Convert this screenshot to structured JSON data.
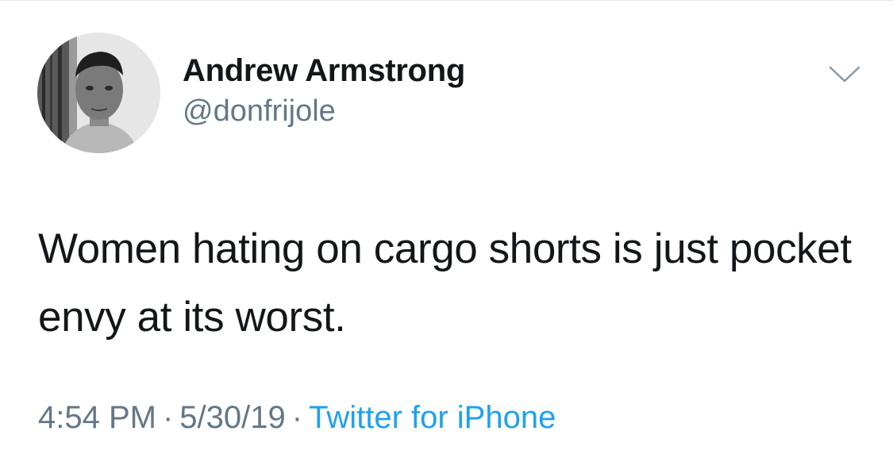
{
  "tweet": {
    "author": {
      "display_name": "Andrew Armstrong",
      "handle": "@donfrijole"
    },
    "text": "Women hating on cargo shorts is just pocket envy at its worst.",
    "time": "4:54 PM",
    "separator": "·",
    "date": "5/30/19",
    "source": "Twitter for iPhone"
  },
  "icons": {
    "avatar": "profile-photo",
    "menu": "chevron-down-icon"
  },
  "colors": {
    "text": "#14171a",
    "secondary": "#657786",
    "link": "#1da1f2",
    "chevron": "#8899a6"
  }
}
